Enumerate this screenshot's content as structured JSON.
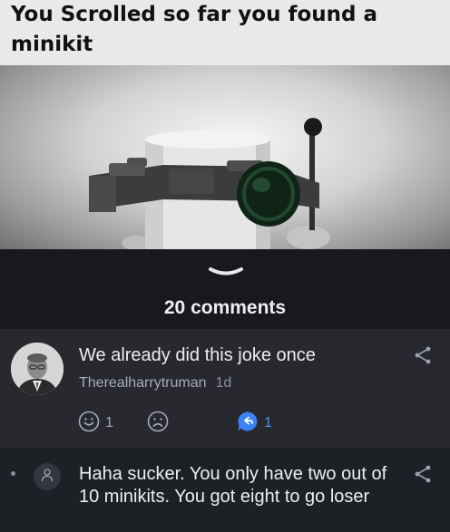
{
  "meme": {
    "caption": "You Scrolled so far you found a minikit"
  },
  "comments_section": {
    "count_label": "20 comments",
    "comments": [
      {
        "text": "We already did this joke once",
        "author": "Therealharrytruman",
        "time": "1d",
        "smile_count": "1",
        "reply_count": "1"
      },
      {
        "text": "Haha sucker. You only have two out of 10 minikits. You got eight to go loser"
      }
    ]
  },
  "colors": {
    "background": "#1d2025",
    "card": "#27292e",
    "accent": "#4a8ff7"
  },
  "icons": [
    "chevron-down-icon",
    "share-icon",
    "smile-icon",
    "sad-icon",
    "reply-icon",
    "user-icon"
  ]
}
